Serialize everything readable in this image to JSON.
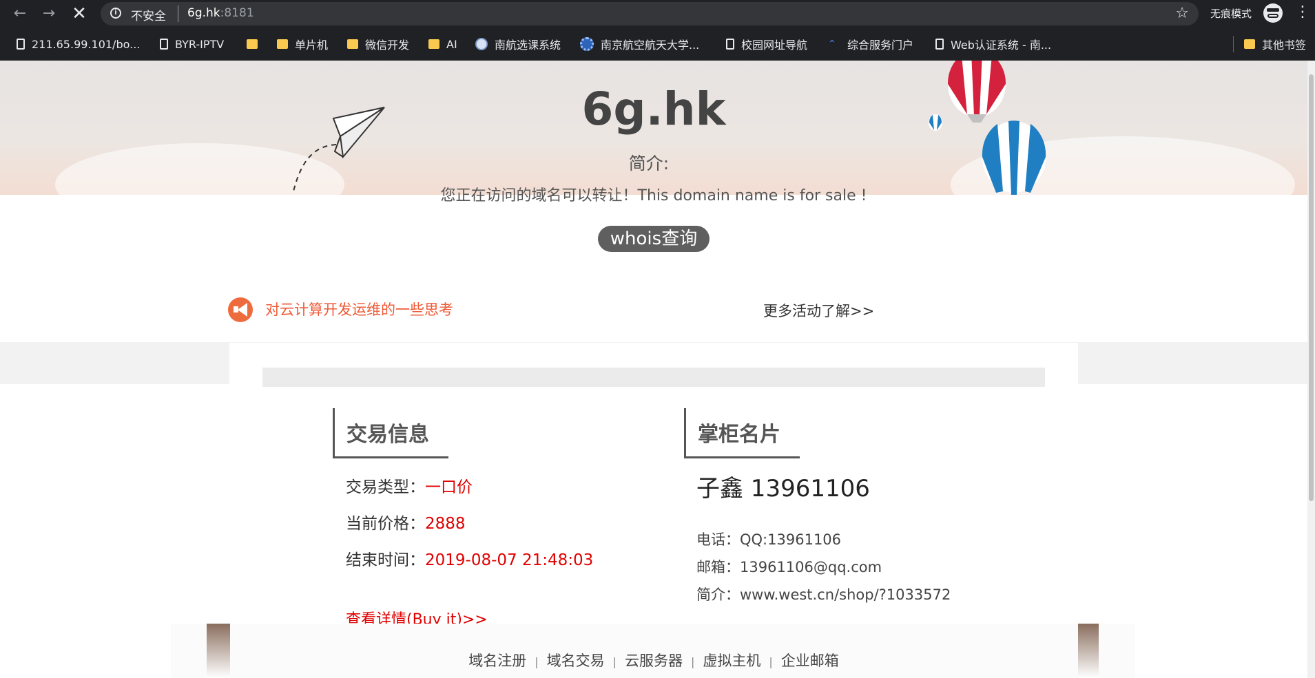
{
  "browser": {
    "security_label": "不安全",
    "url_host": "6g.hk",
    "url_port": ":8181",
    "incognito_label": "无痕模式"
  },
  "bookmarks": [
    {
      "label": "211.65.99.101/bo...",
      "icon": "page-icon"
    },
    {
      "label": "BYR-IPTV",
      "icon": "page-icon"
    },
    {
      "label": "",
      "icon": "folder-icon"
    },
    {
      "label": "单片机",
      "icon": "folder-icon"
    },
    {
      "label": "微信开发",
      "icon": "folder-icon"
    },
    {
      "label": "AI",
      "icon": "folder-icon"
    },
    {
      "label": "南航选课系统",
      "icon": "globe-icon"
    },
    {
      "label": "南京航空航天大学...",
      "icon": "university-icon"
    },
    {
      "label": "校园网址导航",
      "icon": "page-icon"
    },
    {
      "label": "综合服务门户",
      "icon": "chevron-logo-icon"
    },
    {
      "label": "Web认证系统 - 南...",
      "icon": "page-icon"
    },
    {
      "label": "其他书签",
      "icon": "folder-icon"
    }
  ],
  "hero": {
    "title": "6g.hk",
    "intro_label": "简介:",
    "intro_text": "您正在访问的域名可以转让！This domain name is for sale !",
    "whois_button": "whois查询"
  },
  "notice": {
    "link_text": "对云计算开发运维的一些思考",
    "more_text": "更多活动了解>>"
  },
  "trade": {
    "title": "交易信息",
    "rows": [
      {
        "label": "交易类型：",
        "value": "一口价"
      },
      {
        "label": "当前价格：",
        "value": "2888"
      },
      {
        "label": "结束时间：",
        "value": "2019-08-07 21:48:03"
      }
    ],
    "buy_link": "查看详情(Buy it)>>"
  },
  "owner": {
    "title": "掌柜名片",
    "name": "子鑫 13961106",
    "rows": [
      {
        "label": "电话：",
        "value": "QQ:13961106"
      },
      {
        "label": "邮箱：",
        "value": "13961106@qq.com"
      },
      {
        "label": "简介：",
        "value": "www.west.cn/shop/?1033572"
      }
    ]
  },
  "footer": {
    "links": [
      "域名注册",
      "域名交易",
      "云服务器",
      "虚拟主机",
      "企业邮箱"
    ],
    "divider": "|"
  },
  "colors": {
    "accent_red": "#e00000",
    "notice_orange": "#ee5a36",
    "whois_bg": "#5f5f5f"
  }
}
